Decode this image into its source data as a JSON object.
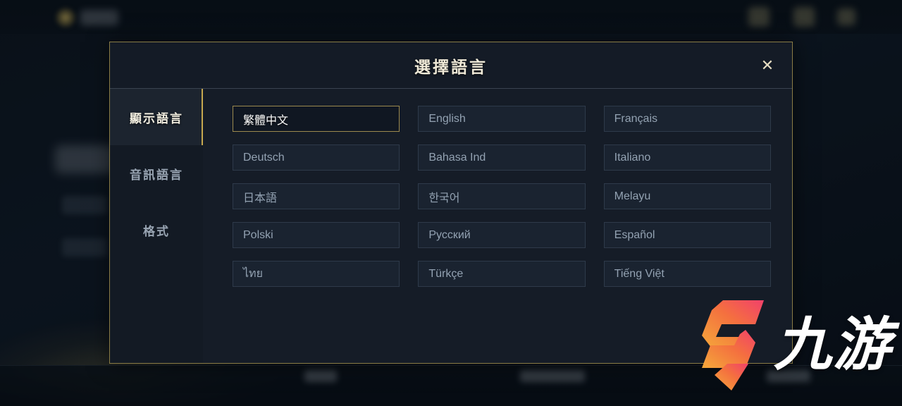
{
  "dialog": {
    "title": "選擇語言",
    "close_label": "✕",
    "close_icon": "close-icon"
  },
  "sidebar": {
    "tabs": [
      {
        "label": "顯示語言",
        "active": true
      },
      {
        "label": "音訊語言",
        "active": false
      },
      {
        "label": "格式",
        "active": false
      }
    ]
  },
  "languages": [
    {
      "label": "繁體中文",
      "selected": true
    },
    {
      "label": "English",
      "selected": false
    },
    {
      "label": "Français",
      "selected": false
    },
    {
      "label": "Deutsch",
      "selected": false
    },
    {
      "label": "Bahasa Ind",
      "selected": false
    },
    {
      "label": "Italiano",
      "selected": false
    },
    {
      "label": "日本語",
      "selected": false
    },
    {
      "label": "한국어",
      "selected": false
    },
    {
      "label": "Melayu",
      "selected": false
    },
    {
      "label": "Polski",
      "selected": false
    },
    {
      "label": "Русский",
      "selected": false
    },
    {
      "label": "Español",
      "selected": false
    },
    {
      "label": "ไทย",
      "selected": false
    },
    {
      "label": "Türkçe",
      "selected": false
    },
    {
      "label": "Tiếng Việt",
      "selected": false
    }
  ],
  "watermark": {
    "text": "九游",
    "mark_icon": "jiuyou-logo-icon",
    "gradient_from": "#f5a93a",
    "gradient_to": "#f2416b"
  },
  "colors": {
    "dialog_border": "#8a7c46",
    "dialog_bg": "#151c27",
    "accent_gold": "#c7a94f",
    "selected_border": "#9c8a4e",
    "button_bg": "#1a2330",
    "button_border": "#2e3a4a",
    "button_text": "#93a2b2",
    "title_text": "#f0ead8"
  }
}
